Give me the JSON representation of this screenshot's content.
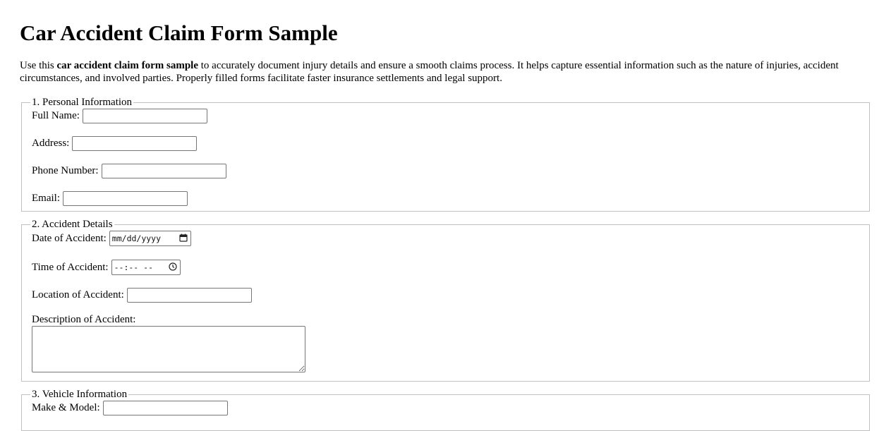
{
  "title": "Car Accident Claim Form Sample",
  "intro": {
    "prefix": "Use this ",
    "bold": "car accident claim form sample",
    "suffix": " to accurately document injury details and ensure a smooth claims process. It helps capture essential information such as the nature of injuries, accident circumstances, and involved parties. Properly filled forms facilitate faster insurance settlements and legal support."
  },
  "sections": {
    "personal": {
      "legend": "1. Personal Information",
      "full_name_label": "Full Name:",
      "address_label": "Address:",
      "phone_label": "Phone Number:",
      "email_label": "Email:"
    },
    "accident": {
      "legend": "2. Accident Details",
      "date_label": "Date of Accident:",
      "date_placeholder": "mm/dd/yyyy",
      "time_label": "Time of Accident:",
      "time_placeholder": "--:-- --",
      "location_label": "Location of Accident:",
      "description_label": "Description of Accident:"
    },
    "vehicle": {
      "legend": "3. Vehicle Information",
      "make_model_label": "Make & Model:"
    }
  },
  "icons": {
    "date": "calendar-icon",
    "time": "clock-icon"
  }
}
